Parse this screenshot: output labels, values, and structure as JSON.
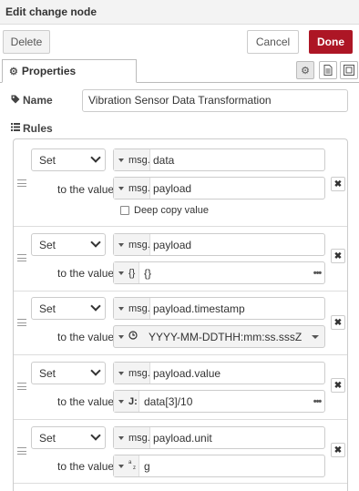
{
  "dialog": {
    "title": "Edit change node"
  },
  "buttons": {
    "delete": "Delete",
    "cancel": "Cancel",
    "done": "Done"
  },
  "tabs": {
    "properties": "Properties"
  },
  "name": {
    "label": "Name",
    "value": "Vibration Sensor Data Transformation"
  },
  "rules_label": "Rules",
  "rules": [
    {
      "action": "Set",
      "to_label": "to the value",
      "target_prefix": "msg.",
      "target": "data",
      "value_prefix": "msg.",
      "value": "payload",
      "deep_copy_label": "Deep copy value"
    },
    {
      "action": "Set",
      "to_label": "to the value",
      "target_prefix": "msg.",
      "target": "payload",
      "value_prefix": "{}",
      "value": "{}"
    },
    {
      "action": "Set",
      "to_label": "to the value",
      "target_prefix": "msg.",
      "target": "payload.timestamp",
      "value": "YYYY-MM-DDTHH:mm:ss.sssZ"
    },
    {
      "action": "Set",
      "to_label": "to the value",
      "target_prefix": "msg.",
      "target": "payload.value",
      "value_prefix": "J:",
      "value": "data[3]/10"
    },
    {
      "action": "Set",
      "to_label": "to the value",
      "target_prefix": "msg.",
      "target": "payload.unit",
      "value": "g"
    }
  ]
}
